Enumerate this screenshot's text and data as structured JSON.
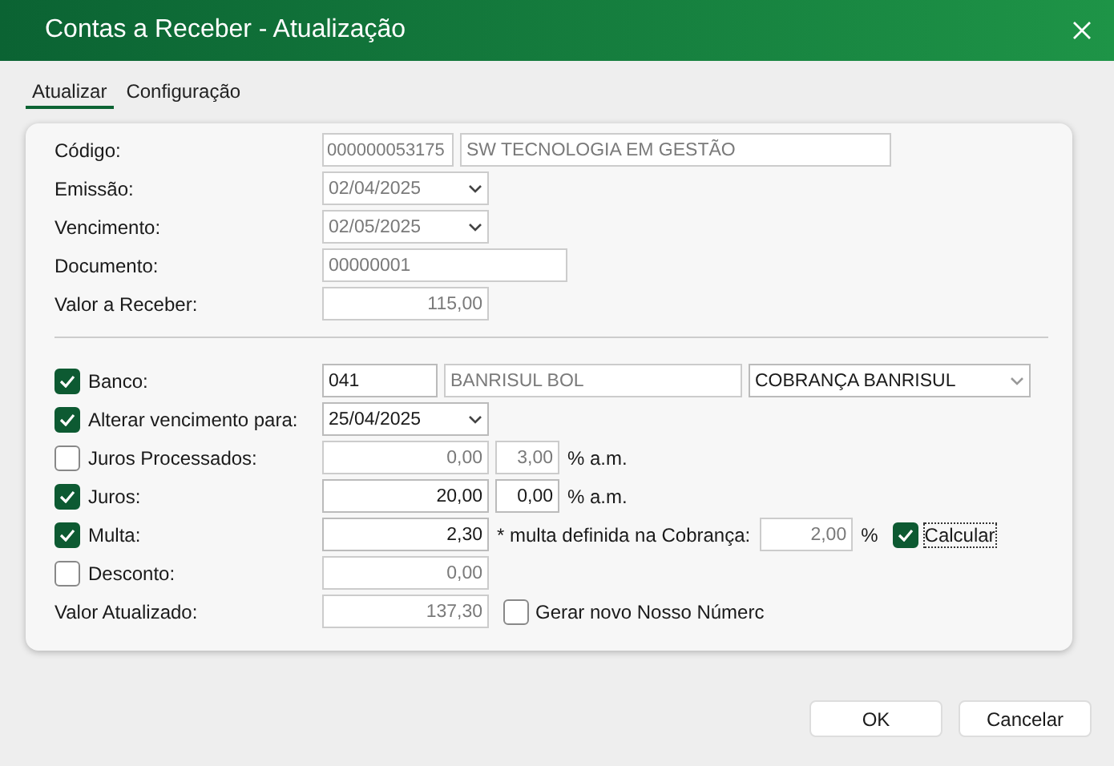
{
  "window": {
    "title": "Contas a Receber - Atualização"
  },
  "tabs": [
    {
      "label": "Atualizar",
      "selected": true
    },
    {
      "label": "Configuração",
      "selected": false
    }
  ],
  "sections": [
    {
      "rows": [
        {
          "kind": "plain",
          "label": "Código:",
          "items": [
            {
              "kind": "code",
              "value": "000000053175",
              "disabled": true
            },
            {
              "kind": "name",
              "value": "SW TECNOLOGIA EM GESTÃO",
              "disabled": true
            }
          ]
        },
        {
          "kind": "plain",
          "label": "Emissão:",
          "items": [
            {
              "kind": "date",
              "value": "02/04/2025",
              "disabled": true
            }
          ]
        },
        {
          "kind": "plain",
          "label": "Vencimento:",
          "items": [
            {
              "kind": "date",
              "value": "02/05/2025",
              "disabled": true
            }
          ]
        },
        {
          "kind": "plain",
          "label": "Documento:",
          "items": [
            {
              "kind": "doc",
              "value": "00000001",
              "disabled": true
            }
          ]
        },
        {
          "kind": "plain",
          "label": "Valor a Receber:",
          "items": [
            {
              "kind": "amount",
              "value": "115,00",
              "disabled": true
            }
          ]
        }
      ]
    },
    {
      "rows": [
        {
          "kind": "check",
          "label": "Banco:",
          "checked": true,
          "items": [
            {
              "kind": "bankcode",
              "value": "041",
              "disabled": false
            },
            {
              "kind": "bankname",
              "value": "BANRISUL BOL",
              "disabled": true
            },
            {
              "kind": "select",
              "value": "COBRANÇA BANRISUL",
              "disabled": false
            }
          ]
        },
        {
          "kind": "check",
          "label": "Alterar vencimento para:",
          "checked": true,
          "items": [
            {
              "kind": "date",
              "value": "25/04/2025",
              "disabled": false
            }
          ]
        },
        {
          "kind": "check",
          "label": "Juros Processados:",
          "checked": false,
          "items": [
            {
              "kind": "amount",
              "value": "0,00",
              "disabled": true
            },
            {
              "kind": "rate",
              "value": "3,00",
              "disabled": true
            },
            {
              "kind": "text",
              "text": "% a.m."
            }
          ]
        },
        {
          "kind": "check",
          "label": "Juros:",
          "checked": true,
          "items": [
            {
              "kind": "amount",
              "value": "20,00",
              "disabled": false
            },
            {
              "kind": "rate",
              "value": "0,00",
              "disabled": false
            },
            {
              "kind": "text",
              "text": "% a.m."
            }
          ]
        },
        {
          "kind": "check",
          "label": "Multa:",
          "checked": true,
          "items": [
            {
              "kind": "amount",
              "value": "2,30",
              "disabled": false
            },
            {
              "kind": "text",
              "text": "* multa definida na Cobrança:"
            },
            {
              "kind": "fine",
              "value": "2,00",
              "disabled": true
            },
            {
              "kind": "text",
              "text": "%"
            },
            {
              "kind": "check",
              "label": "Calcular",
              "checked": true,
              "focused": true
            }
          ]
        },
        {
          "kind": "check",
          "label": "Desconto:",
          "checked": false,
          "items": [
            {
              "kind": "amount",
              "value": "0,00",
              "disabled": true
            }
          ]
        },
        {
          "kind": "plain",
          "label": "Valor Atualizado:",
          "items": [
            {
              "kind": "amount",
              "value": "137,30",
              "disabled": true
            },
            {
              "kind": "check",
              "label": "Gerar novo Nosso Númerc",
              "checked": false,
              "focused": false
            }
          ]
        }
      ]
    }
  ],
  "buttons": [
    "OK",
    "Cancelar"
  ]
}
